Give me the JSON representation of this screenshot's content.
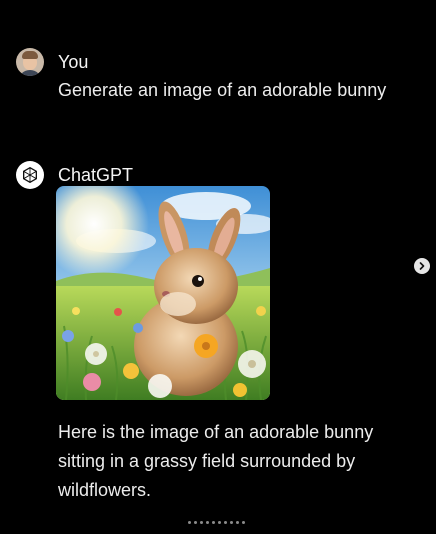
{
  "conversation": {
    "user": {
      "name": "You",
      "message": "Generate an image of an adorable bunny",
      "avatar_icon": "user-photo-avatar"
    },
    "assistant": {
      "name": "ChatGPT",
      "avatar_icon": "openai-logo-icon",
      "image_subject": "bunny in grassy field with wildflowers",
      "message": "Here is the image of an adorable bunny sitting in a grassy field surrounded by wildflowers."
    }
  },
  "carousel": {
    "next_icon": "chevron-right-icon",
    "page_dots": 10
  },
  "colors": {
    "background": "#000000",
    "text": "#ececec"
  }
}
